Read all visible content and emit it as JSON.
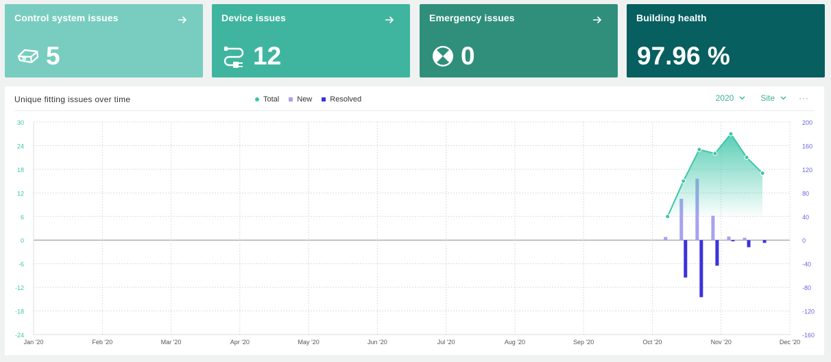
{
  "cards": [
    {
      "title": "Control system issues",
      "value": "5",
      "icon": "controller-icon",
      "bg": "#78cdc0"
    },
    {
      "title": "Device issues",
      "value": "12",
      "icon": "plug-icon",
      "bg": "#3fb59f"
    },
    {
      "title": "Emergency issues",
      "value": "0",
      "icon": "emergency-icon",
      "bg": "#308f7b"
    },
    {
      "title": "Building health",
      "value": "97.96 %",
      "icon": "",
      "bg": "#075f5f"
    }
  ],
  "panel": {
    "title": "Unique fitting issues over time",
    "year": "2020",
    "scope": "Site",
    "more": "···"
  },
  "legend": [
    {
      "label": "Total",
      "color": "#3cc6a8"
    },
    {
      "label": "New",
      "color": "#a7a2f0"
    },
    {
      "label": "Resolved",
      "color": "#3c32dc"
    }
  ],
  "chart_data": {
    "type": "bar",
    "title": "Unique fitting issues over time",
    "x_tick_labels": [
      "Jan '20",
      "Feb '20",
      "Mar '20",
      "Apr '20",
      "May '20",
      "Jun '20",
      "Jul '20",
      "Aug '20",
      "Sep '20",
      "Oct '20",
      "Nov '20",
      "Dec '20"
    ],
    "left_axis": {
      "ticks": [
        30,
        24,
        18,
        12,
        6,
        0,
        -6,
        -12,
        -18,
        -24
      ],
      "range": [
        -24,
        30
      ]
    },
    "right_axis": {
      "ticks": [
        200,
        160,
        120,
        80,
        40,
        0,
        -40,
        -80,
        -120,
        -160
      ],
      "range": [
        -160,
        200
      ]
    },
    "weeks_x": [
      40.1,
      41.1,
      42.1,
      43.1,
      44.1,
      45.1,
      46.1,
      47.1
    ],
    "series": [
      {
        "name": "Total",
        "kind": "area-line",
        "axis": "left",
        "values": [
          6,
          15,
          23,
          22,
          27,
          21,
          17
        ]
      },
      {
        "name": "New",
        "kind": "bar",
        "axis": "left",
        "values": [
          0.8,
          10.5,
          15.6,
          6.2,
          0.9,
          0.6,
          0
        ]
      },
      {
        "name": "Resolved",
        "kind": "bar",
        "axis": "left",
        "values": [
          0,
          -9.5,
          -14.5,
          -6.5,
          -0.3,
          -1.8,
          -0.7
        ]
      }
    ]
  }
}
